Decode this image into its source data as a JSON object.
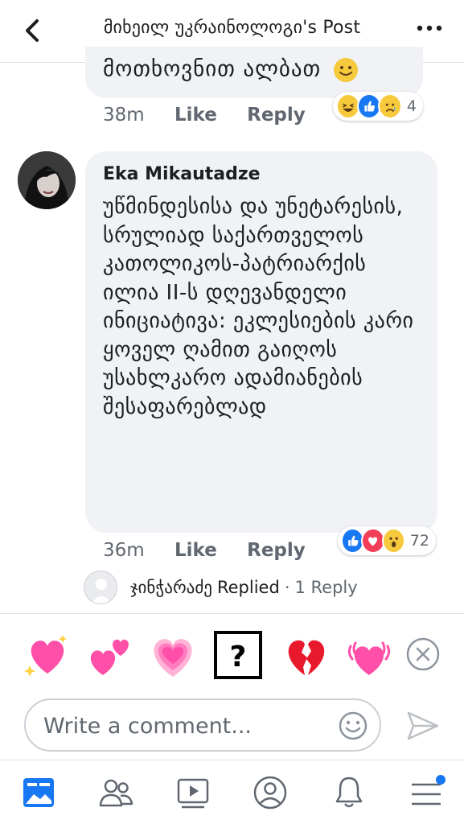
{
  "header": {
    "title": "მიხეილ უკრაინოლოგი's Post"
  },
  "previous_comment": {
    "text_tail": "მოთხოვნით ალბათ",
    "time": "38m",
    "like_label": "Like",
    "reply_label": "Reply",
    "reaction_count": "4",
    "reactions": [
      "haha",
      "like",
      "sad"
    ]
  },
  "comment": {
    "author": "Eka Mikautadze",
    "text": "უწმინდესისა და უნეტარესის, სრულიად საქართველოს კათოლიკოს-პატრიარქის ილია II-ს დღევანდელი ინიციატივა: ეკლესიების კარი ყოველ ღამით გაიღოს უსახლკარო ადამიანების შესაფარებლად",
    "time": "36m",
    "like_label": "Like",
    "reply_label": "Reply",
    "reaction_count": "72",
    "reactions": [
      "like",
      "love",
      "wow"
    ]
  },
  "reply_summary": {
    "name": "ჯინჭარაძე",
    "action": "Replied",
    "separator": "·",
    "count": "1 Reply"
  },
  "emoji_tray": {
    "items": [
      "sparkling-heart",
      "two-hearts",
      "growing-heart",
      "unknown-glyph",
      "broken-heart",
      "beating-heart"
    ],
    "unknown_glyph": "?"
  },
  "composer": {
    "placeholder": "Write a comment..."
  },
  "bottom_nav": {
    "items": [
      "news-feed",
      "friends",
      "watch",
      "profile",
      "notifications",
      "menu"
    ],
    "badge_color": "#1877f2"
  },
  "colors": {
    "bubble": "#f0f2f5",
    "like_blue": "#1877f2",
    "love_red": "#f33e58",
    "secondary_text": "#606770",
    "heart_pink": "#ff4fa8"
  }
}
